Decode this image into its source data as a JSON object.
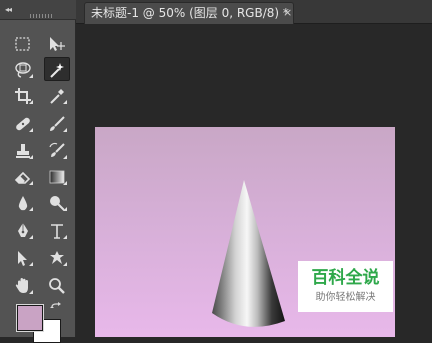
{
  "toolbar": {
    "collapse_glyph": "◂◂",
    "active_tool": "magic-wand-tool",
    "tools": [
      {
        "name": "rectangular-marquee-tool",
        "icon": "rectangle-marquee-icon"
      },
      {
        "name": "move-tool",
        "icon": "move-icon"
      },
      {
        "name": "lasso-tool",
        "icon": "lasso-icon"
      },
      {
        "name": "magic-wand-tool",
        "icon": "magic-wand-icon"
      },
      {
        "name": "crop-tool",
        "icon": "crop-icon"
      },
      {
        "name": "eyedropper-tool",
        "icon": "eyedropper-icon"
      },
      {
        "name": "spot-healing-brush-tool",
        "icon": "bandage-icon"
      },
      {
        "name": "brush-tool",
        "icon": "brush-icon"
      },
      {
        "name": "clone-stamp-tool",
        "icon": "stamp-icon"
      },
      {
        "name": "history-brush-tool",
        "icon": "history-brush-icon"
      },
      {
        "name": "eraser-tool",
        "icon": "eraser-icon"
      },
      {
        "name": "gradient-tool",
        "icon": "gradient-icon"
      },
      {
        "name": "blur-tool",
        "icon": "blur-drop-icon"
      },
      {
        "name": "dodge-tool",
        "icon": "dodge-icon"
      },
      {
        "name": "pen-tool",
        "icon": "pen-icon"
      },
      {
        "name": "type-tool",
        "icon": "type-icon"
      },
      {
        "name": "path-selection-tool",
        "icon": "path-select-arrow-icon"
      },
      {
        "name": "custom-shape-tool",
        "icon": "shape-icon"
      },
      {
        "name": "hand-tool",
        "icon": "hand-icon"
      },
      {
        "name": "zoom-tool",
        "icon": "zoom-icon"
      }
    ],
    "foreground_color": "#c9a3c4",
    "background_color": "#ffffff"
  },
  "document": {
    "tab_title": "未标题-1 @ 50% (图层 0, RGB/8) *",
    "close_glyph": "×"
  },
  "canvas": {
    "gradient_top": "#c9a7c6",
    "gradient_bottom": "#e8b8ea",
    "object": "cone"
  },
  "watermark": {
    "title": "百科全说",
    "subtitle": "助你轻松解决",
    "color": "#2ea84a"
  }
}
